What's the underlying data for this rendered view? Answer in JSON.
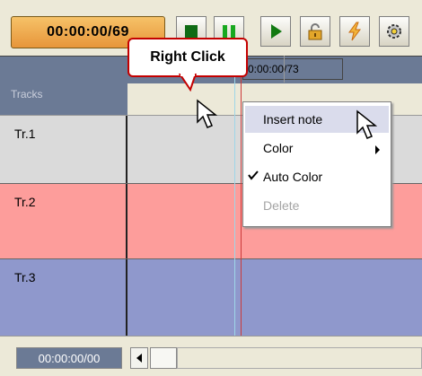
{
  "toolbar": {
    "time_display": "00:00:00/69",
    "buttons": [
      {
        "icon": "stop-icon"
      },
      {
        "icon": "pause-icon"
      },
      {
        "icon": "play-icon"
      },
      {
        "icon": "lock-icon"
      },
      {
        "icon": "lightning-icon"
      },
      {
        "icon": "settings-icon"
      }
    ]
  },
  "ruler": {
    "position_text": "0:00:00/73"
  },
  "tracks": {
    "header": "Tracks",
    "items": [
      {
        "label": "Tr.1",
        "color": "#dadada"
      },
      {
        "label": "Tr.2",
        "color": "#fd9d9b"
      },
      {
        "label": "Tr.3",
        "color": "#8f98cc"
      }
    ]
  },
  "callout": {
    "text": "Right Click"
  },
  "context_menu": {
    "items": [
      {
        "label": "Insert note",
        "state": "highlighted"
      },
      {
        "label": "Color",
        "has_submenu": true
      },
      {
        "label": "Auto Color",
        "checked": true
      },
      {
        "label": "Delete",
        "disabled": true
      }
    ]
  },
  "statusbar": {
    "time": "00:00:00/00"
  },
  "colors": {
    "accent_orange": "#e7953a",
    "header_bar": "#6b7a95",
    "callout_border": "#c40000",
    "menu_highlight": "#dadcec"
  }
}
